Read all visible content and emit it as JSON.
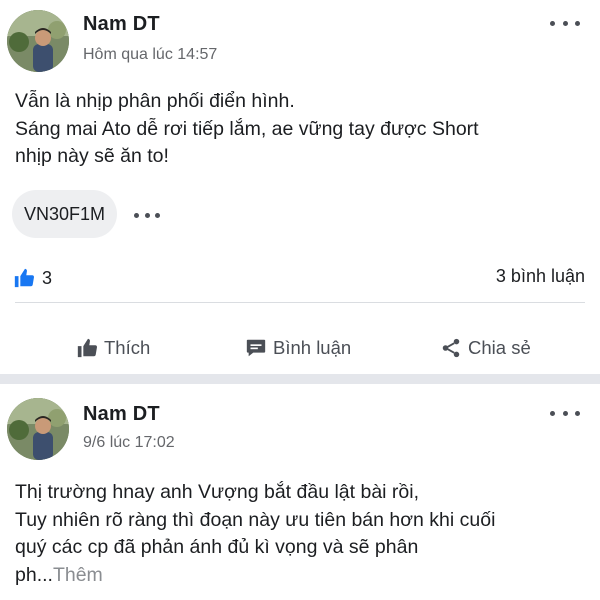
{
  "posts": [
    {
      "author": "Nam DT",
      "timestamp": "Hôm qua lúc 14:57",
      "body": "Vẫn là nhịp phân phối điển hình.\nSáng mai Ato dễ rơi tiếp lắm, ae vững tay được Short\nnhịp này sẽ ăn to!",
      "tag": "VN30F1M",
      "like_count": "3",
      "comments": "3 bình luận",
      "actions": {
        "like": "Thích",
        "comment": "Bình luận",
        "share": "Chia sẻ"
      }
    },
    {
      "author": "Nam DT",
      "timestamp": "9/6 lúc 17:02",
      "body": "Thị trường hnay anh Vượng bắt đầu lật bài rồi,\nTuy nhiên rõ ràng thì đoạn này ưu tiên bán hơn khi cuối\nquý các cp đã phản ánh đủ kì vọng và sẽ phân\nph...",
      "see_more": "Thêm"
    }
  ],
  "colors": {
    "accent": "#1877f2",
    "muted": "#65676b",
    "separator": "#e4e6eb"
  },
  "icons": [
    "more-icon",
    "like-icon",
    "comment-icon",
    "share-icon"
  ]
}
